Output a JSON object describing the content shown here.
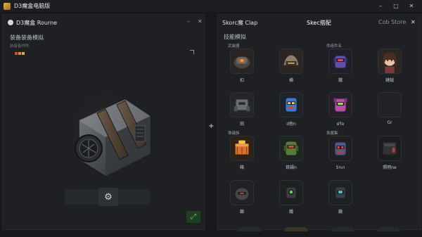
{
  "window": {
    "title": "D3魔盒电脑版",
    "buttons": [
      "–",
      "□",
      "✕"
    ]
  },
  "left_panel": {
    "title": "D3魔盒 Rourne",
    "min_label": "–",
    "close_label": "✕",
    "subtitle": "装备装备模拟",
    "hint": "装备备样陈",
    "swatches": [
      "#d9493a",
      "#e0892b",
      "#d2b23d"
    ],
    "gear_icon": "⚙",
    "expand_icon": "⤢"
  },
  "right_panel": {
    "tab_left": "Skorc魔 Clap",
    "tab_center": "Skec搭配",
    "tab_right": "Cob Store",
    "close_label": "✕",
    "subtitle": "技能模拟",
    "categories": [
      {
        "label": "武装器",
        "color": "#3ea35a"
      },
      {
        "label": "件组件名",
        "color": "#3ea35a"
      },
      {
        "label": "珠键族",
        "color": "#3ea35a"
      },
      {
        "label": "珠属集",
        "color": "#d94c3c"
      }
    ],
    "items": [
      {
        "name": "扣",
        "icon": "rust-mech-icon"
      },
      {
        "name": "横",
        "icon": "tank-helmet-icon"
      },
      {
        "name": "鐵",
        "icon": "purple-robot-icon"
      },
      {
        "name": "鏈鉞",
        "icon": "girl-avatar-icon"
      },
      {
        "name": "田",
        "icon": "gray-mech-icon"
      },
      {
        "name": "d他n",
        "icon": "blue-robot-icon"
      },
      {
        "name": "ฝร้อ",
        "icon": "pink-robot-icon"
      },
      {
        "name": "Gr",
        "icon": "empty-slot-icon"
      },
      {
        "name": "箱",
        "icon": "orange-crate-icon"
      },
      {
        "name": "鉄鍋n",
        "icon": "green-robot-icon"
      },
      {
        "name": "Sรเก",
        "icon": "red-robot-icon"
      },
      {
        "name": "照明ne",
        "icon": "black-box-icon"
      },
      {
        "name": "鎖",
        "icon": "dark-bot-icon"
      },
      {
        "name": "鐵",
        "icon": "green-eye-bot-icon"
      },
      {
        "name": "鏡",
        "icon": "teal-bot-icon"
      }
    ]
  }
}
